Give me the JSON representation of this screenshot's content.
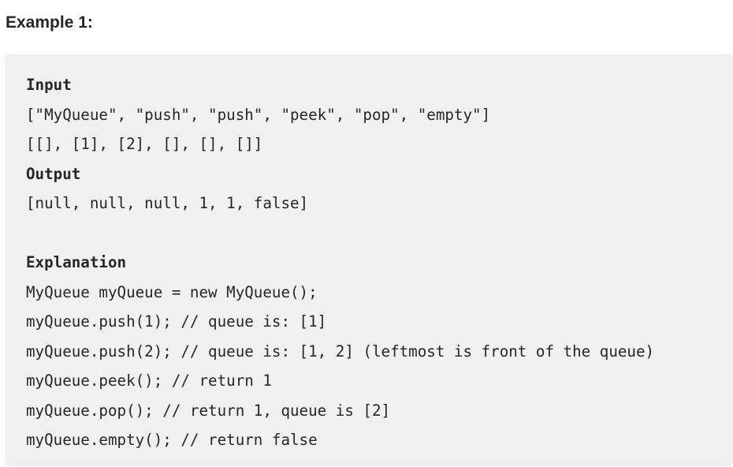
{
  "example": {
    "title": "Example 1:",
    "input_label": "Input",
    "input_lines": [
      "[\"MyQueue\", \"push\", \"push\", \"peek\", \"pop\", \"empty\"]",
      "[[], [1], [2], [], [], []]"
    ],
    "output_label": "Output",
    "output_line": "[null, null, null, 1, 1, false]",
    "explanation_label": "Explanation",
    "explanation_lines": [
      "MyQueue myQueue = new MyQueue();",
      "myQueue.push(1); // queue is: [1]",
      "myQueue.push(2); // queue is: [1, 2] (leftmost is front of the queue)",
      "myQueue.peek(); // return 1",
      "myQueue.pop(); // return 1, queue is [2]",
      "myQueue.empty(); // return false"
    ]
  }
}
